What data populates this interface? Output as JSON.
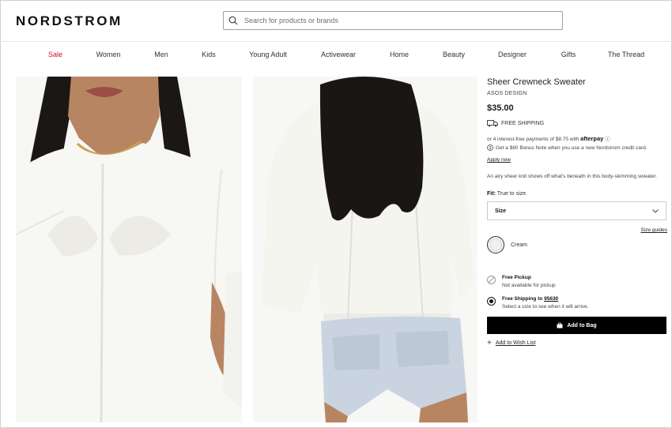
{
  "header": {
    "logo": "NORDSTROM",
    "search_placeholder": "Search for products or brands"
  },
  "nav": {
    "items": [
      "Sale",
      "Women",
      "Men",
      "Kids",
      "Young Adult",
      "Activewear",
      "Home",
      "Beauty",
      "Designer",
      "Gifts",
      "The Thread"
    ]
  },
  "product": {
    "title": "Sheer Crewneck Sweater",
    "brand": "ASOS DESIGN",
    "price": "$35.00",
    "free_shipping": "FREE SHIPPING",
    "afterpay_text": "or 4 interest-free payments of $8.75 with",
    "afterpay_brand": "afterpay",
    "afterpay_info": "ⓘ",
    "bonus_text": "Get a $60 Bonus Note when you use a new Nordstrom credit card.",
    "apply_now": "Apply now",
    "description": "An airy sheer knit shows off what's beneath in this body-skimming sweater.",
    "fit_label": "Fit:",
    "fit_value": "True to size.",
    "size_label": "Size",
    "size_guides": "Size guides",
    "color_name": "Cream",
    "pickup_title": "Free Pickup",
    "pickup_sub": "Not available for pickup",
    "shipping_title": "Free Shipping to",
    "shipping_zip": "95630",
    "shipping_sub": "Select a size to see when it will arrive.",
    "add_to_bag": "Add to Bag",
    "wish_list": "Add to Wish List"
  },
  "colors": {
    "sale": "#c8102e",
    "button": "#000000",
    "swatch": "#f1f0ec"
  }
}
